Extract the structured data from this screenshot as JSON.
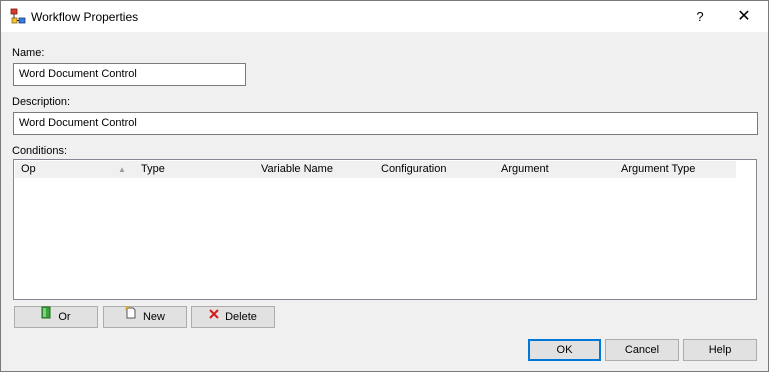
{
  "window": {
    "title": "Workflow Properties",
    "help_glyph": "?",
    "close_glyph": "✕",
    "icon": "workflow-icon"
  },
  "form": {
    "name_label": "Name:",
    "name_value": "Word Document Control",
    "description_label": "Description:",
    "description_value": "Word Document Control",
    "conditions_label": "Conditions:"
  },
  "conditions_table": {
    "columns": [
      "Op",
      "Type",
      "Variable Name",
      "Configuration",
      "Argument",
      "Argument Type"
    ],
    "sort_indicator": "▲",
    "rows": []
  },
  "condition_buttons": {
    "or_label": "Or",
    "new_label": "New",
    "delete_label": "Delete"
  },
  "dialog_buttons": {
    "ok_label": "OK",
    "cancel_label": "Cancel",
    "help_label": "Help"
  },
  "colors": {
    "default_button_border": "#0078d7",
    "delete_icon": "#d61b1b",
    "or_icon": "#3aa33a"
  }
}
